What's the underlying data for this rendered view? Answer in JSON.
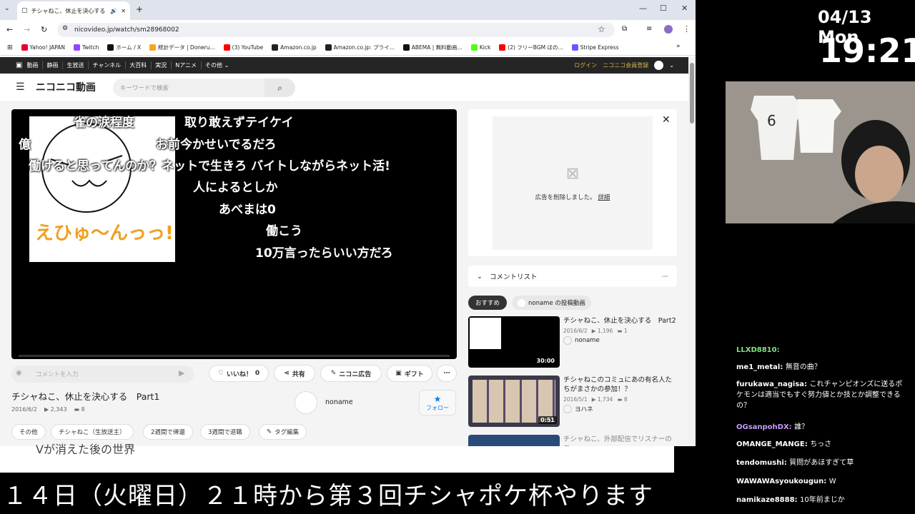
{
  "browser": {
    "tab_title": "チシャねこ、休止を決心する",
    "url": "nicovideo.jp/watch/sm28968002",
    "bookmarks": [
      {
        "label": "Yahoo! JAPAN",
        "color": "#e60033"
      },
      {
        "label": "Twitch",
        "color": "#9146ff"
      },
      {
        "label": "ホーム / X",
        "color": "#111111"
      },
      {
        "label": "統計データ | Doneru...",
        "color": "#f5a623"
      },
      {
        "label": "(3) YouTube",
        "color": "#ff0000"
      },
      {
        "label": "Amazon.co.jp",
        "color": "#222222"
      },
      {
        "label": "Amazon.co.jp: プライ...",
        "color": "#222222"
      },
      {
        "label": "ABEMA | 無料動画...",
        "color": "#111111"
      },
      {
        "label": "Kick",
        "color": "#53fc18"
      },
      {
        "label": "(2) フリーBGM ほの...",
        "color": "#ff0000"
      },
      {
        "label": "Stripe Express",
        "color": "#635bff"
      }
    ]
  },
  "nico": {
    "topnav": [
      "動画",
      "静画",
      "生放送",
      "チャンネル",
      "大百科",
      "実況",
      "Nアニメ",
      "その他"
    ],
    "login": "ログイン",
    "register": "ニコニコ会員登録",
    "logo": "ニコニコ動画",
    "search_placeholder": "キーワードで検索"
  },
  "video": {
    "comments": [
      "雀の涙程度",
      "取り敢えずテイケイ",
      "億",
      "お前今かせいでるだろ",
      "働けると思ってんのか？ネットで生きろ バイトしながらネット活!",
      "人によるとしか",
      "あべまは0",
      "働こう",
      "10万言ったらいい方だろ"
    ],
    "thumb_text": "えひゅ〜んっっ!!",
    "comment_placeholder": "コメントを入力",
    "like_label": "いいね！",
    "like_count": "0",
    "share_label": "共有",
    "ad_label": "ニコニ広告",
    "gift_label": "ギフト",
    "title": "チシャねこ、休止を決心する　Part1",
    "date": "2016/6/2",
    "views": "2,343",
    "comments_count": "8",
    "owner": "noname",
    "follow_label": "フォロー",
    "tags": [
      "その他",
      "チシャねこ（生放送主）",
      "2週間で帰還",
      "3週間で退職"
    ],
    "tag_edit": "タグ編集"
  },
  "sidebar": {
    "ad_removed": "広告を削除しました。",
    "ad_detail": "詳細",
    "comment_list": "コメントリスト",
    "rec_tab": "おすすめ",
    "owner_tab": "noname の投稿動画",
    "related": [
      {
        "title": "チシャねこ、休止を決心する　Part2",
        "date": "2016/6/2",
        "views": "1,196",
        "comments": "1",
        "user": "noname",
        "duration": "30:00"
      },
      {
        "title": "チシャねこのコミュにあの有名人たちがまさかの参加！？",
        "date": "2016/5/1",
        "views": "1,734",
        "comments": "8",
        "user": "ヨハネ",
        "duration": "0:51"
      },
      {
        "title": "チシャねこ、外部配信でリスナーのコ",
        "date": "",
        "views": "",
        "comments": "",
        "user": "",
        "duration": ""
      }
    ]
  },
  "overlay": {
    "date": "04/13 Mon",
    "time": "19:21",
    "banner": "１４日（火曜日）２１時から第３回チシャポケ杯やります",
    "below_text": "Vが消えた後の世界",
    "chat": [
      {
        "user": "LLXD8810",
        "msg": "",
        "color": "#7ee37e"
      },
      {
        "user": "me1_metal",
        "msg": "無音の曲？",
        "color": "#ffffff"
      },
      {
        "user": "furukawa_nagisa",
        "msg": "これチャンピオンズに送るポケモンは適当でもすぐ努力値とか技とか調整できるの？",
        "color": "#ffffff"
      },
      {
        "user": "OGsanpohDX",
        "msg": "誰？",
        "color": "#c79bff"
      },
      {
        "user": "OMANGE_MANGE",
        "msg": "ちっさ",
        "color": "#ffffff"
      },
      {
        "user": "tendomushi",
        "msg": "質問があほすぎて草",
        "color": "#ffffff"
      },
      {
        "user": "WAWAWAsyoukougun",
        "msg": "W",
        "color": "#ffffff"
      },
      {
        "user": "namikaze8888",
        "msg": "10年前まじか",
        "color": "#ffffff"
      }
    ]
  }
}
